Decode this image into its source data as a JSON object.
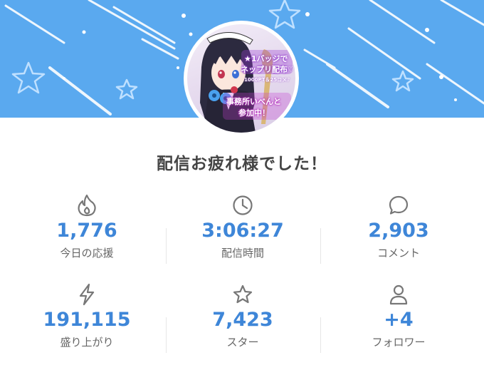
{
  "banner": {
    "color": "#5aa9ef"
  },
  "avatar": {
    "texts": [
      "★1バッジで",
      "ネップリ配布♡",
      "1000PT＆25コメ♪",
      "事務所いべんと",
      "参加中！"
    ]
  },
  "title": "配信お疲れ様でした！",
  "stats": [
    {
      "icon": "fire-icon",
      "value": "1,776",
      "label": "今日の応援"
    },
    {
      "icon": "clock-icon",
      "value": "3:06:27",
      "label": "配信時間"
    },
    {
      "icon": "comment-icon",
      "value": "2,903",
      "label": "コメント"
    },
    {
      "icon": "lightning-icon",
      "value": "191,115",
      "label": "盛り上がり"
    },
    {
      "icon": "star-icon",
      "value": "7,423",
      "label": "スター"
    },
    {
      "icon": "user-icon",
      "value": "+4",
      "label": "フォロワー"
    }
  ],
  "colors": {
    "accent": "#3e86d8",
    "label": "#666666",
    "title": "#444444"
  }
}
